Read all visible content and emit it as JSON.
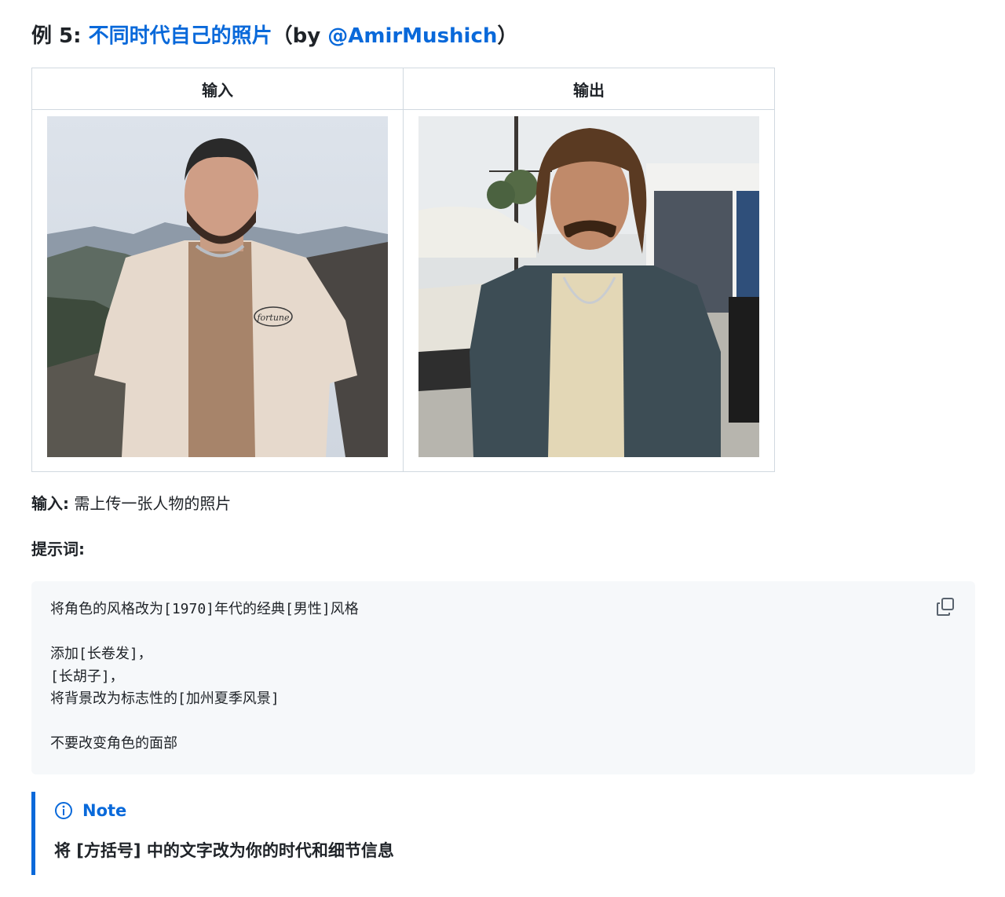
{
  "heading": {
    "prefix": "例 5: ",
    "title_link": "不同时代自己的照片",
    "open_paren": "（by ",
    "author_link": "@AmirMushich",
    "close_paren": "）"
  },
  "table": {
    "headers": [
      "输入",
      "输出"
    ],
    "input_photo_text": "fortune"
  },
  "input_line": {
    "label": "输入:",
    "text": " 需上传一张人物的照片"
  },
  "prompt_label": "提示词:",
  "code_block": {
    "text": "将角色的风格改为[1970]年代的经典[男性]风格\n\n添加[长卷发]，\n[长胡子]，\n将背景改为标志性的[加州夏季风景]\n\n不要改变角色的面部",
    "copy_icon": "copy-icon"
  },
  "note": {
    "title": "Note",
    "icon": "info-icon",
    "body": "将 [方括号] 中的文字改为你的时代和细节信息"
  },
  "colors": {
    "link": "#0969da",
    "code_bg": "#f6f8fa",
    "border": "#d1d9e0",
    "text": "#1f2328"
  }
}
